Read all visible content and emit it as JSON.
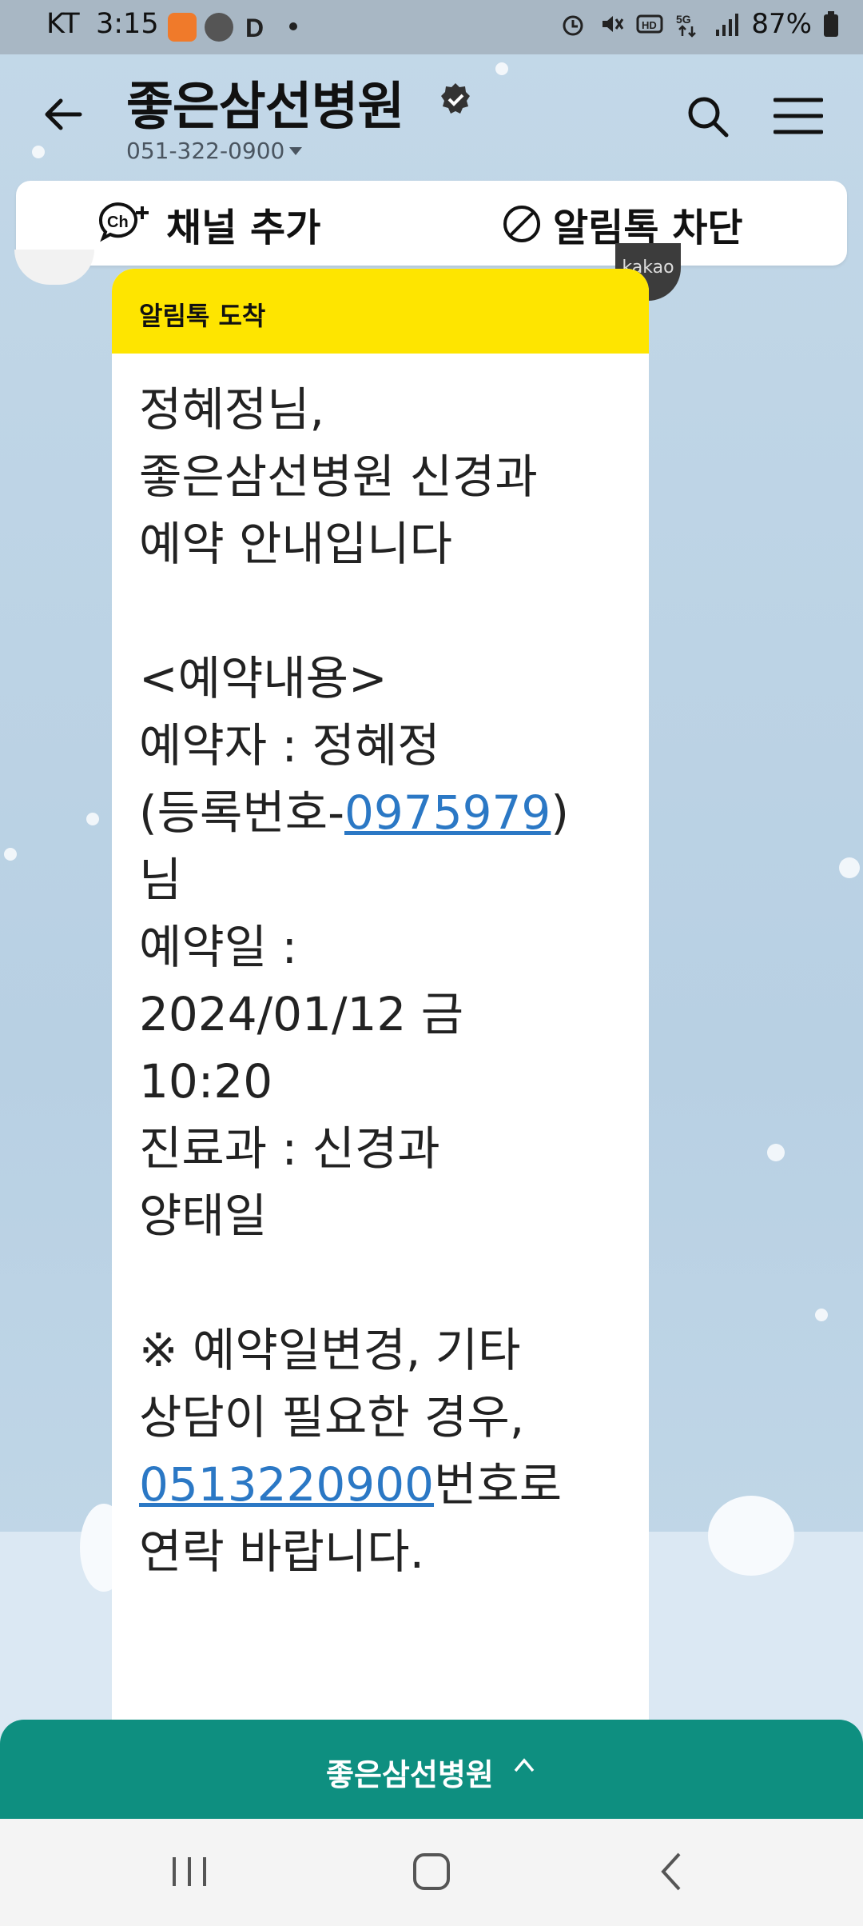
{
  "status_bar": {
    "carrier": "KT",
    "time": "3:15",
    "battery": "87%"
  },
  "header": {
    "title": "좋은삼선병원",
    "phone": "051-322-0900"
  },
  "channel_actions": {
    "add_label": "채널 추가",
    "block_label": "알림톡 차단"
  },
  "badge": {
    "label": "kakao"
  },
  "message": {
    "header": "알림톡 도착",
    "lines": {
      "l1": "정혜정님,",
      "l2": "좋은삼선병원 신경과",
      "l3": "예약 안내입니다",
      "l4": "<예약내용>",
      "l5": "예약자 : 정혜정",
      "l6_pre": "(등록번호-",
      "l6_link": "0975979",
      "l6_post": ")",
      "l7": "님",
      "l8": "예약일 :",
      "l9": "2024/01/12 금",
      "l10": "10:20",
      "l11": "진료과 : 신경과",
      "l12": "양태일",
      "l13": "※ 예약일변경, 기타",
      "l14": "상담이 필요한 경우,",
      "l15_link": "0513220900",
      "l15_post": "번호로",
      "l16": "연락 바랍니다."
    }
  },
  "bottom_menu": {
    "label": "좋은삼선병원"
  },
  "colors": {
    "accent_yellow": "#fee500",
    "bottom_green": "#0e8f80",
    "link_blue": "#2b78c5"
  },
  "icons": [
    "back-arrow-icon",
    "verified-icon",
    "search-icon",
    "menu-icon",
    "channel-add-icon",
    "block-icon",
    "recent-apps-icon",
    "home-icon",
    "nav-back-icon"
  ]
}
